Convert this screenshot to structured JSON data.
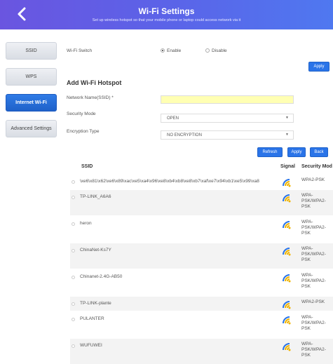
{
  "header": {
    "title": "Wi-Fi Settings",
    "subtitle": "Set up wireless hotspot so that your mobile phone or laptop could access network via it"
  },
  "sidebar": {
    "items": [
      {
        "label": "SSID"
      },
      {
        "label": "WPS"
      },
      {
        "label": "Internet Wi-Fi"
      },
      {
        "label": "Advanced Settings"
      }
    ]
  },
  "wifi_switch": {
    "label": "Wi-Fi Switch",
    "enable_label": "Enable",
    "disable_label": "Disable",
    "selected": "Enable"
  },
  "apply_top": "Apply",
  "add_hotspot": {
    "title": "Add Wi-Fi Hotspot",
    "network_name_label": "Network Name(SSID) *",
    "network_name_value": "",
    "security_mode_label": "Security Mode",
    "security_mode_value": "OPEN",
    "encryption_label": "Encryption Type",
    "encryption_value": "NO ENCRYPTION"
  },
  "actions": {
    "refresh": "Refresh",
    "apply": "Apply",
    "back": "Back"
  },
  "table": {
    "col_ssid": "SSID",
    "col_signal": "Signal",
    "col_security": "Security Mod",
    "rows": [
      {
        "ssid": "\\xe6\\x81\\x62\\xe6\\x89\\xac\\xe5\\xa4\\x96\\xe8\\xb4\\xb8\\xe8\\xb7\\xaf\\xe7\\x94\\xb1\\xe5\\x99\\xa8",
        "security": "WPA2-PSK"
      },
      {
        "ssid": "TP-LINK_A6A6",
        "security": "WPA-\nPSK/WPA2-\nPSK"
      },
      {
        "ssid": "heron",
        "security": "WPA-\nPSK/WPA2-\nPSK"
      },
      {
        "ssid": "ChinaNet-Ks7Y",
        "security": "WPA-\nPSK/WPA2-\nPSK"
      },
      {
        "ssid": "Chinanet-2.4G-AB50",
        "security": "WPA-\nPSK/WPA2-\nPSK"
      },
      {
        "ssid": "TP-LINK-plante",
        "security": "WPA2-PSK"
      },
      {
        "ssid": "PULANTER",
        "security": "WPA-\nPSK/WPA2-\nPSK"
      },
      {
        "ssid": "WUFUWEI",
        "security": "WPA-\nPSK/WPA2-\nPSK"
      }
    ]
  },
  "colors": {
    "header_start": "#6a55e0",
    "header_end": "#4f78f0",
    "accent": "#2a74e8",
    "input_highlight": "#ffffb3"
  }
}
